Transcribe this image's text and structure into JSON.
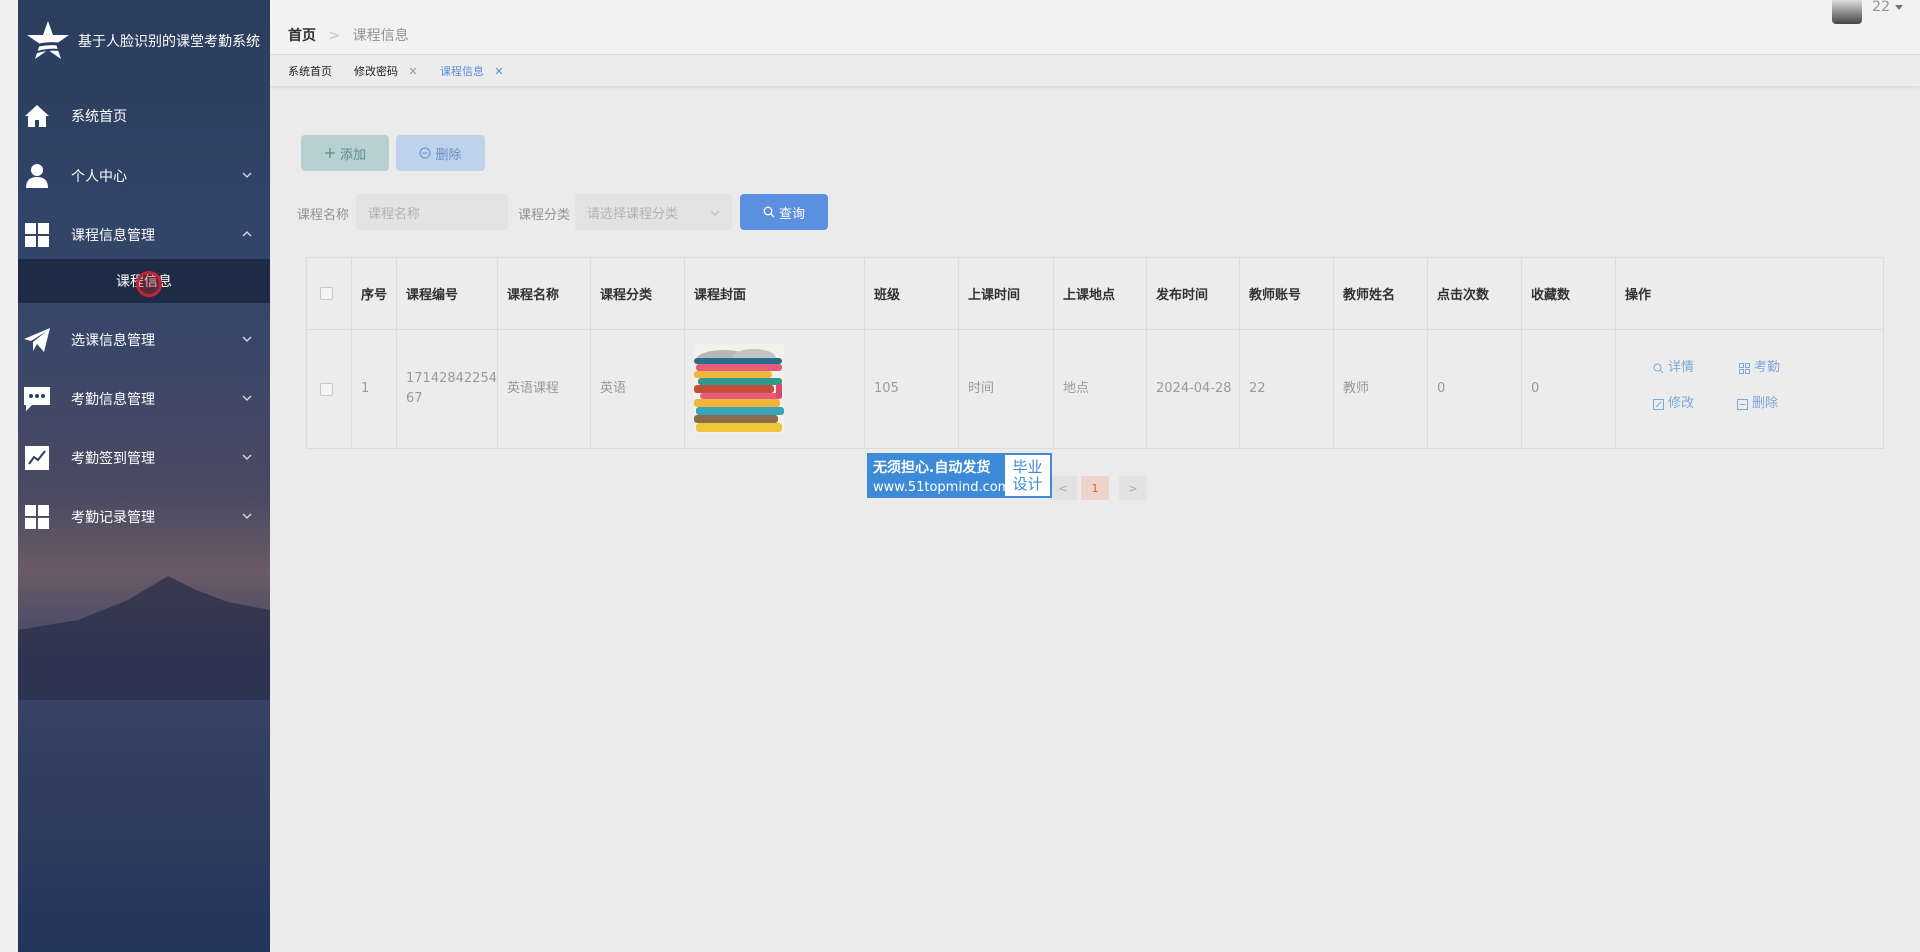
{
  "app": {
    "title": "基于人脸识别的课堂考勤系统"
  },
  "sidebar": {
    "items": [
      {
        "label": "系统首页",
        "icon": "home-icon"
      },
      {
        "label": "个人中心",
        "icon": "user-icon"
      },
      {
        "label": "课程信息管理",
        "icon": "grid-icon",
        "expanded": true
      },
      {
        "label": "选课信息管理",
        "icon": "send-icon"
      },
      {
        "label": "考勤信息管理",
        "icon": "message-icon"
      },
      {
        "label": "考勤签到管理",
        "icon": "chart-icon"
      },
      {
        "label": "考勤记录管理",
        "icon": "grid-icon"
      }
    ],
    "submenu": {
      "label": "课程信息"
    }
  },
  "header": {
    "breadcrumb": {
      "home": "首页",
      "sep": ">",
      "current": "课程信息"
    },
    "user": {
      "name": "22"
    }
  },
  "tabs": [
    {
      "label": "系统首页",
      "closable": false
    },
    {
      "label": "修改密码",
      "closable": true
    },
    {
      "label": "课程信息",
      "closable": true,
      "active": true
    }
  ],
  "toolbar": {
    "add_label": "添加",
    "delete_label": "删除"
  },
  "filters": {
    "name_label": "课程名称",
    "name_placeholder": "课程名称",
    "category_label": "课程分类",
    "category_placeholder": "请选择课程分类",
    "search_label": "查询"
  },
  "table": {
    "headers": [
      "序号",
      "课程编号",
      "课程名称",
      "课程分类",
      "课程封面",
      "班级",
      "上课时间",
      "上课地点",
      "发布时间",
      "教师账号",
      "教师姓名",
      "点击次数",
      "收藏数",
      "操作"
    ],
    "rows": [
      {
        "index": "1",
        "code_line1": "17142842254",
        "code_line2": "67",
        "name": "英语课程",
        "category": "英语",
        "class": "105",
        "time": "时间",
        "place": "地点",
        "published": "2024-04-28",
        "teacher_account": "22",
        "teacher_name": "教师",
        "clicks": "0",
        "favorites": "0",
        "actions": {
          "detail": "详情",
          "attendance": "考勤",
          "edit": "修改",
          "delete": "删除"
        }
      }
    ]
  },
  "pagination": {
    "prev": "<",
    "current": "1",
    "next": ">"
  },
  "watermark": {
    "line1": "无须担心.自动发货",
    "line2": "www.51topmind.com",
    "badge1": "毕业",
    "badge2": "设计"
  },
  "colors": {
    "primary": "#5b8fdf",
    "sidebar_bg": "#2c3e5e",
    "link": "#7ea6db",
    "page_current": "#d65f3e"
  }
}
